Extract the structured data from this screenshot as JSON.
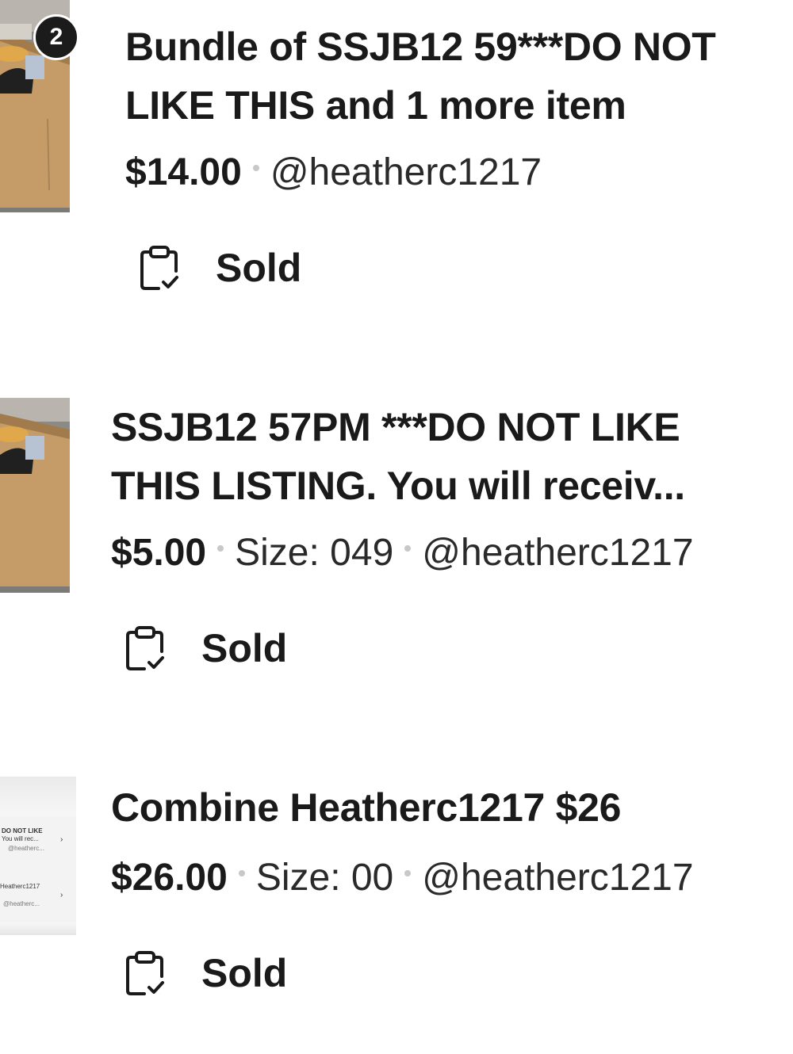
{
  "listings": [
    {
      "badge": "2",
      "title_lines": [
        "Bundle of SSJB12 59***DO NOT",
        "LIKE THIS and 1 more item"
      ],
      "price": "$14.00",
      "size": "",
      "seller": "@heatherc1217",
      "status": "Sold",
      "status_icon": "clipboard-check-icon"
    },
    {
      "title_lines": [
        "SSJB12 57PM ***DO NOT LIKE",
        "THIS LISTING. You will receiv..."
      ],
      "price": "$5.00",
      "size": "Size: 049",
      "seller": "@heatherc1217",
      "status": "Sold",
      "status_icon": "clipboard-check-icon"
    },
    {
      "title_lines": [
        "Combine Heatherc1217 $26"
      ],
      "price": "$26.00",
      "size": "Size: 00",
      "seller": "@heatherc1217",
      "status": "Sold",
      "status_icon": "clipboard-check-icon",
      "thumbnail_text": [
        "DO NOT LIKE",
        "You will rec...",
        "@heatherc...",
        "Heatherc1217",
        "@heatherc..."
      ]
    }
  ]
}
